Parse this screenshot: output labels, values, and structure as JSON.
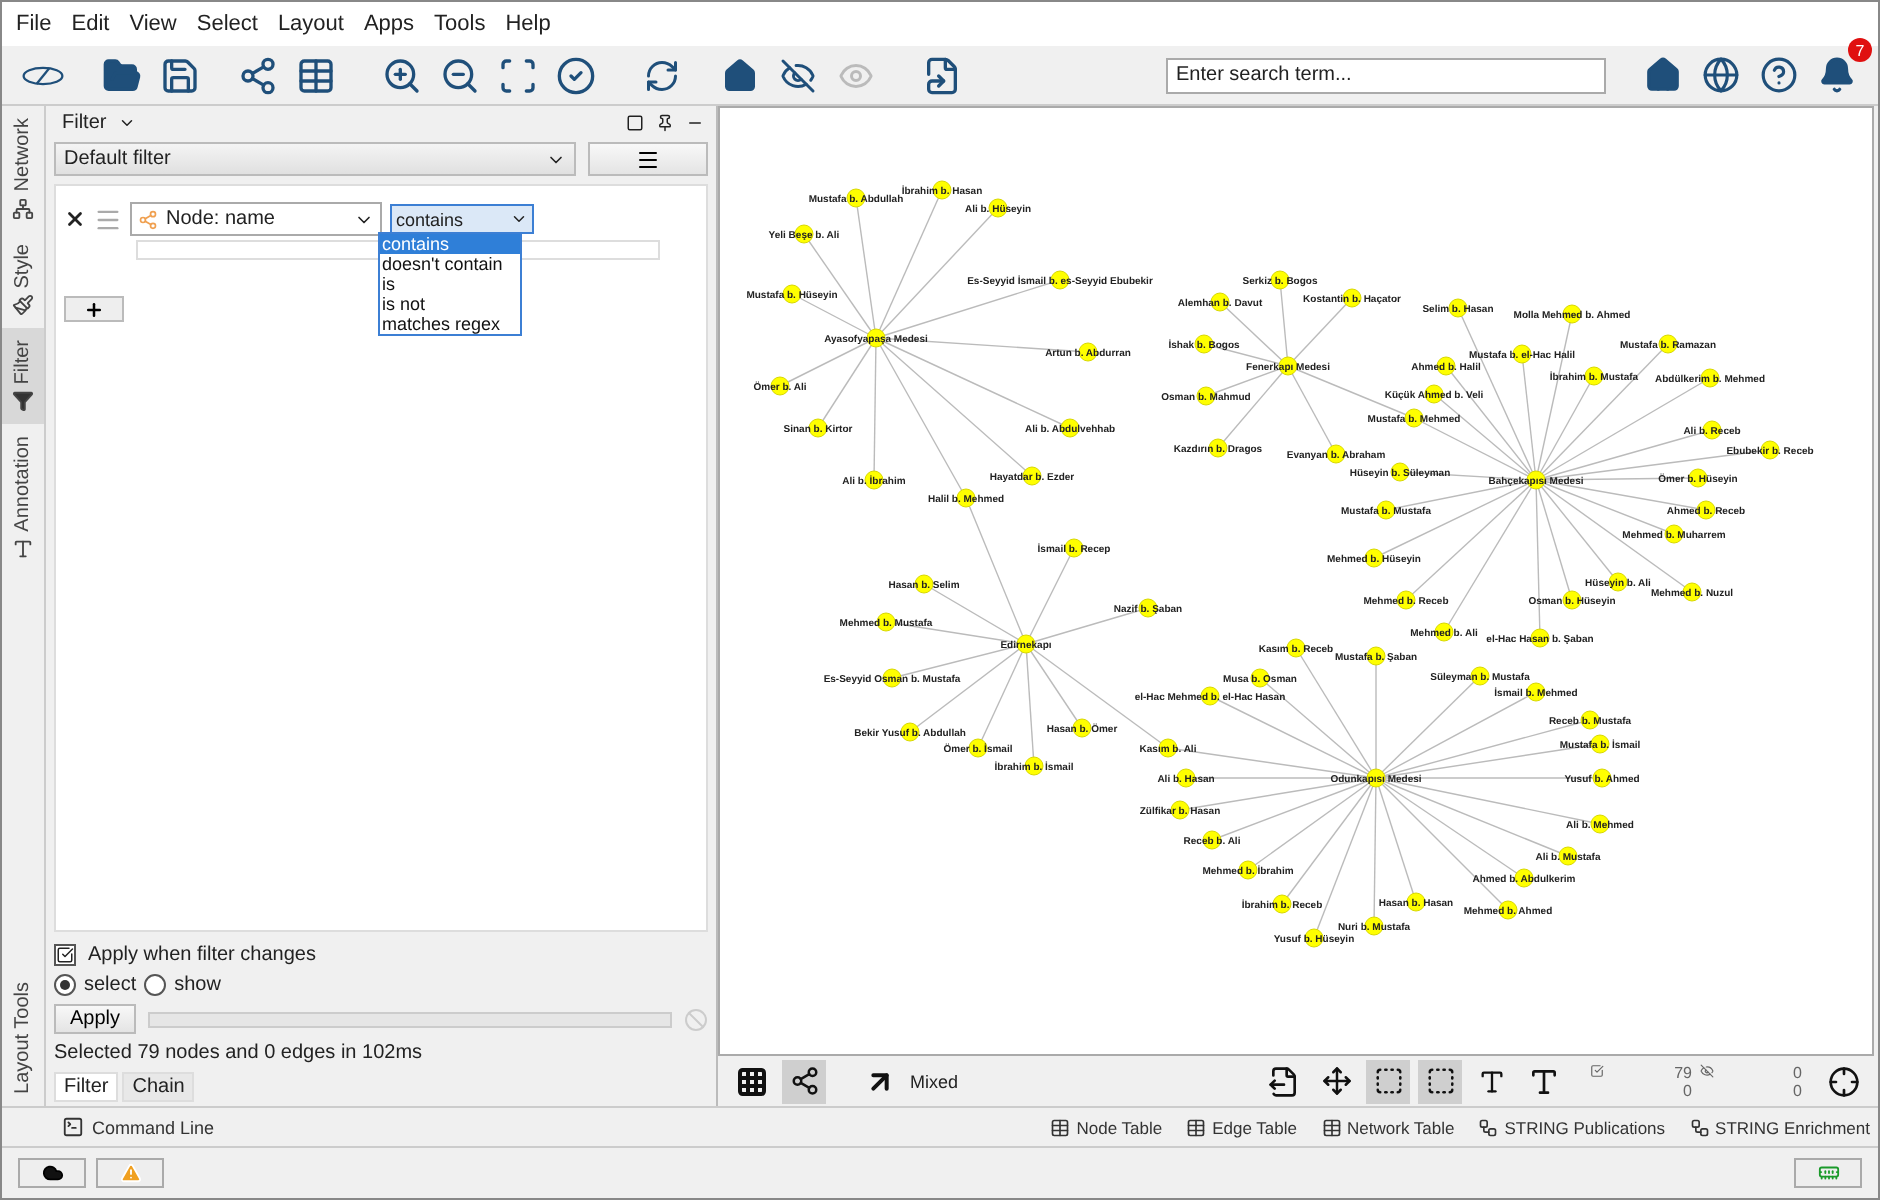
{
  "menu": [
    "File",
    "Edit",
    "View",
    "Select",
    "Layout",
    "Apps",
    "Tools",
    "Help"
  ],
  "toolbar": {
    "search": {
      "placeholder": "Enter search term..."
    },
    "notifications": "7"
  },
  "side_tabs": [
    {
      "label": "Network",
      "selected": false,
      "kind": "network"
    },
    {
      "label": "Style",
      "selected": false,
      "kind": "style"
    },
    {
      "label": "Filter",
      "selected": true,
      "kind": "filter"
    },
    {
      "label": "Annotation",
      "selected": false,
      "kind": "annotation"
    }
  ],
  "layout_tools": "Layout Tools",
  "filter_panel": {
    "title": "Filter",
    "preset": "Default filter",
    "condition": {
      "column": "Node: name",
      "operator": "contains",
      "options": [
        {
          "label": "contains",
          "selected": true
        },
        {
          "label": "doesn't contain",
          "selected": false
        },
        {
          "label": "is",
          "selected": false
        },
        {
          "label": "is not",
          "selected": false
        },
        {
          "label": "matches regex",
          "selected": false
        }
      ]
    },
    "apply_on_change": {
      "label": "Apply when filter changes",
      "checked": true
    },
    "modes": [
      {
        "label": "select",
        "selected": true
      },
      {
        "label": "show",
        "selected": false
      }
    ],
    "apply_button": "Apply",
    "progress": {
      "level": 0
    },
    "status": "Selected 79 nodes and 0 edges in 102ms",
    "tabs": [
      {
        "label": "Filter",
        "selected": true
      },
      {
        "label": "Chain",
        "selected": false
      }
    ]
  },
  "command_line": "Command Line",
  "network": {
    "clusters": [
      {
        "hub": "Ayasofyapaşa Medesi",
        "members": [
          {
            "name": "Mustafa b. Abdullah"
          },
          {
            "name": "İbrahim b. Hasan"
          },
          {
            "name": "Ali b. Hüseyin"
          },
          {
            "name": "Yeli Beşe b. Ali"
          },
          {
            "name": "Es-Seyyid İsmail b. es-Seyyid Ebubekir"
          },
          {
            "name": "Mustafa b. Hüseyin"
          },
          {
            "name": "Artun b. Abdurran"
          },
          {
            "name": "Ömer b. Ali"
          },
          {
            "name": "Sinan b. Kirtor"
          },
          {
            "name": "Ali b. Abdulvehhab"
          },
          {
            "name": "Ali b. İbrahim"
          },
          {
            "name": "Hayatdar b. Ezder"
          },
          {
            "name": "Halil b. Mehmed"
          }
        ]
      },
      {
        "hub": "Edirnekapı",
        "members": [
          {
            "name": "İsmail b. Recep"
          },
          {
            "name": "Hasan b. Selim"
          },
          {
            "name": "Nazif b. Şaban"
          },
          {
            "name": "Mehmed b. Mustafa"
          },
          {
            "name": "Es-Seyyid Osman b. Mustafa"
          },
          {
            "name": "Bekir Yusuf b. Abdullah"
          },
          {
            "name": "Hasan b. Ömer"
          },
          {
            "name": "Ömer b. İsmail"
          },
          {
            "name": "Kasım b. Ali"
          },
          {
            "name": "İbrahim b. İsmail"
          }
        ]
      },
      {
        "hub": "Fenerkapı Medesi",
        "members": [
          {
            "name": "Serkiz b. Bogos"
          },
          {
            "name": "Alemhan b. Davut"
          },
          {
            "name": "Kostantin b. Haçator"
          },
          {
            "name": "İshak b. Bogos"
          },
          {
            "name": "Osman b. Mahmud"
          },
          {
            "name": "Kazdırın b. Dragos"
          },
          {
            "name": "Evanyan b. Abraham"
          },
          {
            "name": "Mustafa b. Mehmed"
          }
        ]
      },
      {
        "hub": "Bahçekapısı Medesi",
        "members": [
          {
            "name": "Selim b. Hasan"
          },
          {
            "name": "Molla Mehmed b. Ahmed"
          },
          {
            "name": "Mustafa b. el-Hac Halil"
          },
          {
            "name": "Mustafa b. Ramazan"
          },
          {
            "name": "Ahmed b. Halil"
          },
          {
            "name": "İbrahim b. Mustafa"
          },
          {
            "name": "Abdülkerim b. Mehmed"
          },
          {
            "name": "Küçük Ahmed b. Veli"
          },
          {
            "name": "Ali b. Receb"
          },
          {
            "name": "Ebubekir b. Receb"
          },
          {
            "name": "Hüseyin b. Süleyman"
          },
          {
            "name": "Ömer b. Hüseyin"
          },
          {
            "name": "Mustafa b. Mustafa"
          },
          {
            "name": "Ahmed b. Receb"
          },
          {
            "name": "Mehmed b. Muharrem"
          },
          {
            "name": "Mehmed b. Hüseyin"
          },
          {
            "name": "Hüseyin b. Ali"
          },
          {
            "name": "Mehmed b. Receb"
          },
          {
            "name": "Osman b. Hüseyin"
          },
          {
            "name": "Mehmed b. Nuzul"
          },
          {
            "name": "Mehmed b. Ali"
          },
          {
            "name": "el-Hac Hasan b. Şaban"
          }
        ]
      },
      {
        "hub": "Odunkapısı Medesi",
        "members": [
          {
            "name": "Kasım b. Receb"
          },
          {
            "name": "Mustafa b. Şaban"
          },
          {
            "name": "Musa b. Osman"
          },
          {
            "name": "Süleyman b. Mustafa"
          },
          {
            "name": "el-Hac Mehmed b. el-Hac Hasan"
          },
          {
            "name": "İsmail b. Mehmed"
          },
          {
            "name": "Receb b. Mustafa"
          },
          {
            "name": "Mustafa b. İsmail"
          },
          {
            "name": "Ali b. Hasan"
          },
          {
            "name": "Yusuf b. Ahmed"
          },
          {
            "name": "Zülfikar b. Hasan"
          },
          {
            "name": "Receb b. Ali"
          },
          {
            "name": "Ali b. Mehmed"
          },
          {
            "name": "Ali b. Mustafa"
          },
          {
            "name": "Mehmed b. İbrahim"
          },
          {
            "name": "Ahmed b. Abdulkerim"
          },
          {
            "name": "İbrahim b. Receb"
          },
          {
            "name": "Hasan b. Hasan"
          },
          {
            "name": "Mehmed b. Ahmed"
          },
          {
            "name": "Nuri b. Mustafa"
          },
          {
            "name": "Yusuf b. Hüseyin"
          }
        ]
      }
    ]
  },
  "view_toolbar": {
    "mode": "Mixed",
    "selected_nodes": "79",
    "selected_edges": "0",
    "hidden_nodes": "0",
    "hidden_edges": "0"
  },
  "table_tabs": [
    {
      "label": "Node Table",
      "kind": "node"
    },
    {
      "label": "Edge Table",
      "kind": "edge"
    },
    {
      "label": "Network Table",
      "kind": "network"
    },
    {
      "label": "STRING Publications",
      "kind": "string"
    },
    {
      "label": "STRING Enrichment",
      "kind": "string"
    }
  ]
}
